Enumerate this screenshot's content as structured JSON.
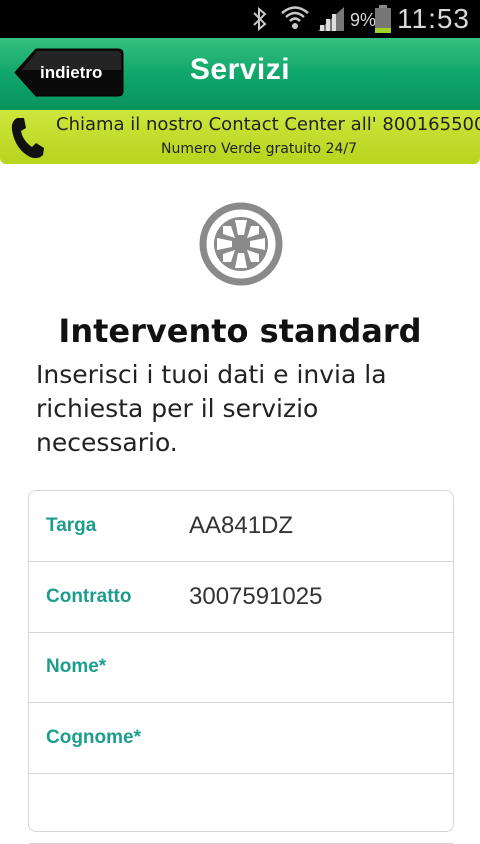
{
  "status_bar": {
    "battery_percent": "9%",
    "time": "11:53",
    "icons": [
      "bluetooth-icon",
      "wifi-icon",
      "signal-icon",
      "battery-icon"
    ]
  },
  "header": {
    "back_label": "indietro",
    "title": "Servizi"
  },
  "contact": {
    "line1": "Chiama il nostro Contact Center all' 800165500",
    "line2": "Numero Verde gratuito 24/7",
    "icon": "phone-icon"
  },
  "service": {
    "icon": "wheel-icon",
    "title": "Intervento standard",
    "description": "Inserisci i tuoi dati e invia la richiesta per il servizio necessario."
  },
  "form": {
    "fields": [
      {
        "label": "Targa",
        "value": "AA841DZ"
      },
      {
        "label": "Contratto",
        "value": "3007591025"
      },
      {
        "label": "Nome*",
        "value": ""
      },
      {
        "label": "Cognome*",
        "value": ""
      },
      {
        "label": "",
        "value": ""
      }
    ]
  },
  "colors": {
    "header_green": "#10a76a",
    "banner_lime": "#c4de30",
    "label_teal": "#1e9d8f"
  }
}
